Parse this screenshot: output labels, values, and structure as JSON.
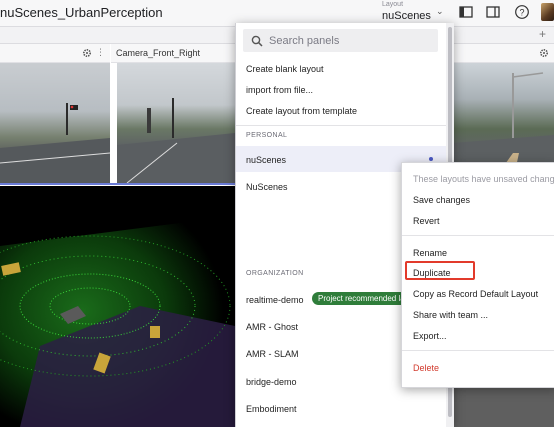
{
  "app": {
    "title": "nuScenes_UrbanPerception"
  },
  "layout_selector": {
    "caption": "Layout",
    "value": "nuScenes"
  },
  "panels": {
    "camera_right_title": "Camera_Front_Right"
  },
  "menu": {
    "search_placeholder": "Search panels",
    "actions": [
      "Create blank layout",
      "import from file...",
      "Create layout from template"
    ],
    "personal_header": "PERSONAL",
    "personal": [
      "nuScenes",
      "NuScenes"
    ],
    "organization_header": "ORGANIZATION",
    "organization": [
      "realtime-demo",
      "AMR - Ghost",
      "AMR - SLAM",
      "bridge-demo",
      "Embodiment"
    ],
    "recommended_badge": "Project recommended layout"
  },
  "context_menu": {
    "note": "These layouts have unsaved changes",
    "save": "Save changes",
    "revert": "Revert",
    "rename": "Rename",
    "duplicate": "Duplicate",
    "copy_default": "Copy as Record Default Layout",
    "share": "Share with team ...",
    "export": "Export...",
    "delete": "Delete"
  },
  "colors": {
    "accent": "#4b59c4",
    "badge": "#2f7d3a",
    "danger": "#e23a2b",
    "highlight": "#e23a2b"
  }
}
